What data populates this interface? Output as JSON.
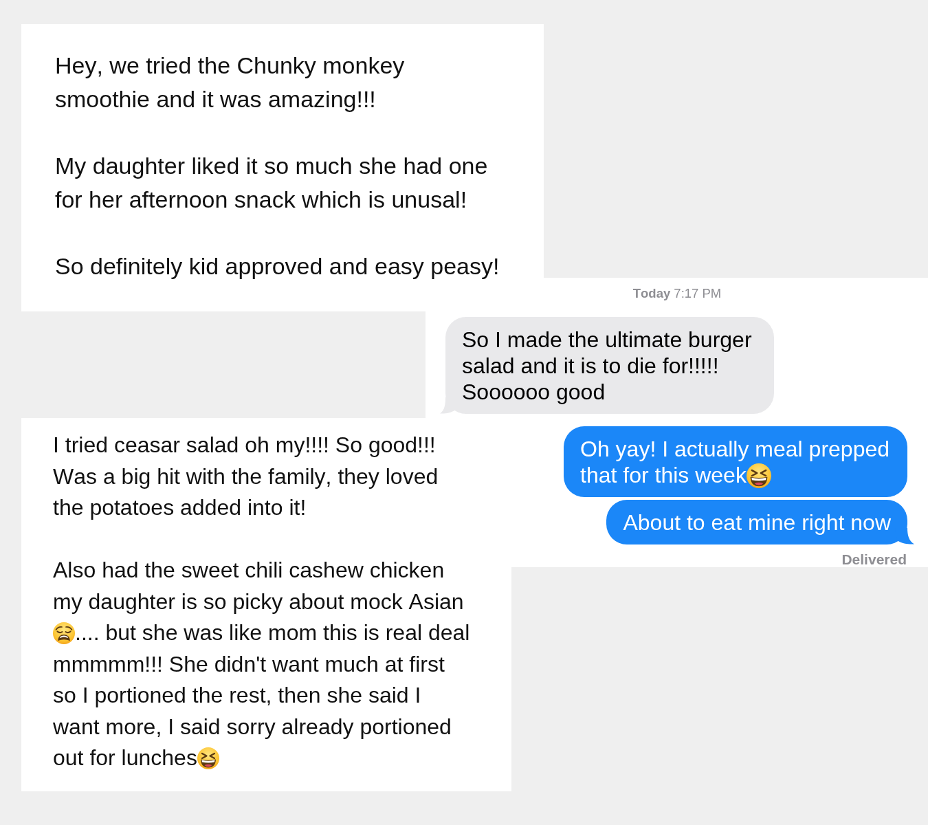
{
  "cards": [
    {
      "kind": "note",
      "paragraphs": [
        [
          {
            "kind": "text",
            "text": "Hey, we tried the Chunky monkey smoothie and it was amazing!!!"
          }
        ],
        [
          {
            "kind": "text",
            "text": "My daughter liked it so much she had one for her afternoon snack which is unusal!"
          }
        ],
        [
          {
            "kind": "text",
            "text": "So definitely kid approved and easy peasy!"
          }
        ]
      ]
    },
    {
      "kind": "chat",
      "timestamp": "**Today** 7:17 PM",
      "messages": [
        {
          "kind": "incoming",
          "tail": true,
          "parts": [
            {
              "kind": "text",
              "text": "So I made the ultimate burger salad and it is to die for!!!!! Soooooo good"
            }
          ]
        },
        {
          "kind": "outgoing",
          "tail": false,
          "parts": [
            {
              "kind": "text",
              "text": "Oh yay! I actually meal prepped"
            },
            {
              "kind": "text",
              "text": "that for this week"
            },
            {
              "kind": "laughing"
            }
          ]
        },
        {
          "kind": "outgoing",
          "tail": true,
          "parts": [
            {
              "kind": "text",
              "text": "About to eat mine right now"
            }
          ]
        }
      ],
      "status": "Delivered"
    },
    {
      "kind": "note",
      "paragraphs": [
        [
          {
            "kind": "text",
            "text": "I tried ceasar salad oh my!!!! So good!!! Was a big hit with the family, they loved the potatoes added into it!"
          }
        ],
        [
          {
            "kind": "text",
            "text": "Also had the sweet chili cashew chicken my daughter is so picky about mock Asian"
          },
          {
            "kind": "weary"
          },
          {
            "kind": "text",
            "text": ".... but she was like mom this is real deal"
          },
          {
            "kind": "text",
            "text": "mmmmm!!! She didn't want much at first so I portioned the rest, then she said I want more, I said sorry already portioned"
          },
          {
            "kind": "text",
            "text": "out for lunches"
          },
          {
            "kind": "laughing"
          }
        ]
      ]
    }
  ]
}
